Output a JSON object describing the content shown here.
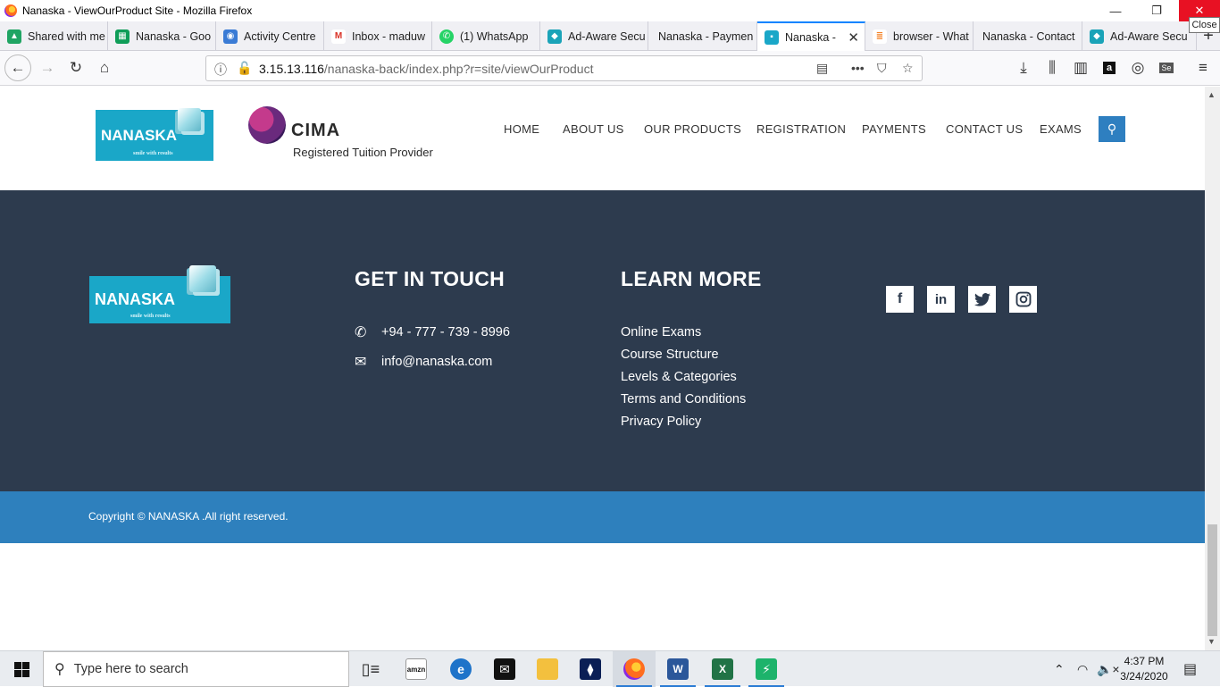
{
  "window": {
    "title": "Nanaska - ViewOurProduct Site - Mozilla Firefox",
    "minimize": "—",
    "maximize": "❐",
    "close": "✕",
    "close_tooltip": "Close"
  },
  "tabs": [
    {
      "label": "Shared with me",
      "icon_name": "google-drive-icon",
      "color": "#1fa463"
    },
    {
      "label": "Nanaska - Goo",
      "icon_name": "google-sheets-icon",
      "color": "#0f9d58"
    },
    {
      "label": "Activity Centre",
      "icon_name": "activity-icon",
      "color": "#3a7bd5"
    },
    {
      "label": "Inbox - maduw",
      "icon_name": "gmail-icon",
      "color": "#d93025"
    },
    {
      "label": "(1) WhatsApp",
      "icon_name": "whatsapp-icon",
      "color": "#25d366"
    },
    {
      "label": "Ad-Aware Secu",
      "icon_name": "shield-icon",
      "color": "#1aa3b8"
    },
    {
      "label": "Nanaska - Paymen",
      "icon_name": "",
      "color": ""
    },
    {
      "label": "Nanaska - V",
      "icon_name": "nanaska-icon",
      "color": "#1aa7c8"
    },
    {
      "label": "browser - What",
      "icon_name": "stackoverflow-icon",
      "color": "#f48024"
    },
    {
      "label": "Nanaska - Contact",
      "icon_name": "",
      "color": ""
    },
    {
      "label": "Ad-Aware Secu",
      "icon_name": "shield-icon",
      "color": "#1aa3b8"
    }
  ],
  "nav": {
    "url_host": "3.15.13.116",
    "url_path": "/nanaska-back/index.php?r=site/viewOurProduct"
  },
  "site": {
    "logo_text": "NANASKA",
    "logo_tagline": "smile with results",
    "cima_word": "CIMA",
    "cima_sub": "Registered Tuition Provider",
    "menu": [
      "HOME",
      "ABOUT US",
      "OUR PRODUCTS",
      "REGISTRATION",
      "PAYMENTS",
      "CONTACT US",
      "EXAMS"
    ]
  },
  "footer": {
    "get_in_touch_title": "GET IN TOUCH",
    "phone": "+94 - 777 - 739 - 8996",
    "email": "info@nanaska.com",
    "learn_more_title": "LEARN MORE",
    "links": [
      "Online Exams",
      "Course Structure",
      "Levels & Categories",
      "Terms and Conditions",
      "Privacy Policy"
    ],
    "social": [
      "f",
      "in",
      "t",
      "ig"
    ],
    "copyright": "Copyright © NANASKA .All right reserved."
  },
  "taskbar": {
    "search_placeholder": "Type here to search",
    "time": "4:37 PM",
    "date": "3/24/2020"
  },
  "colors": {
    "footer_bg": "#2d3b4e",
    "copyright_bg": "#2e80bd",
    "accent": "#2e7fc0",
    "logo_bg": "#1aa7c8"
  }
}
